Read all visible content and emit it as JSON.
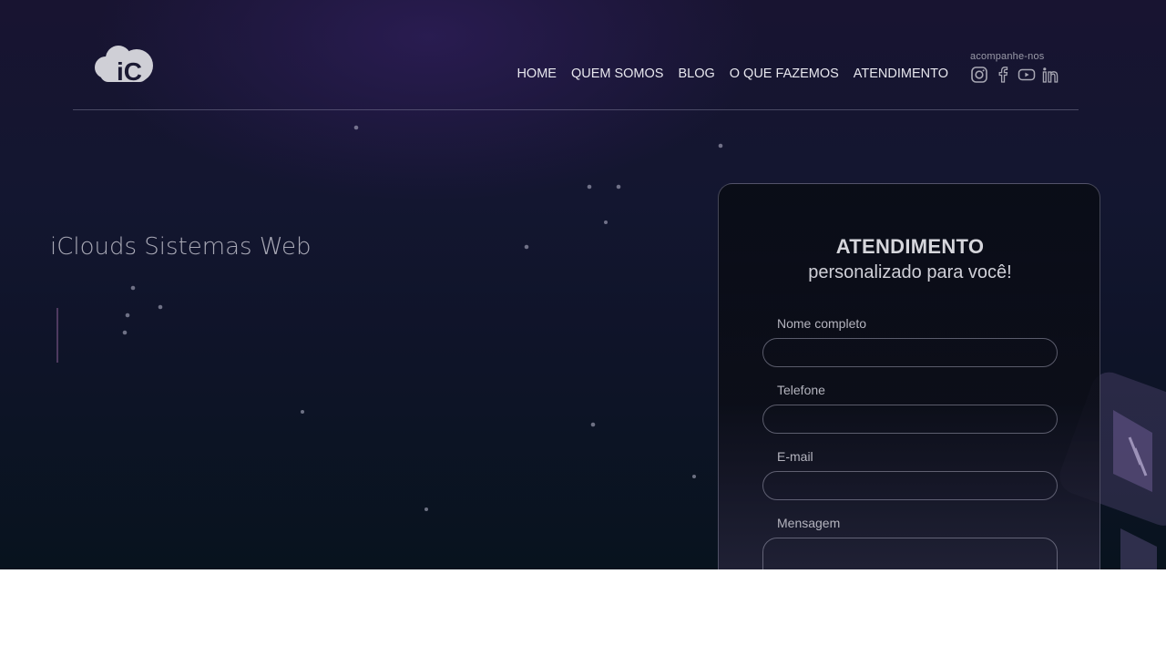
{
  "logo": {
    "text": "iC"
  },
  "nav": {
    "items": [
      "HOME",
      "QUEM SOMOS",
      "BLOG",
      "O QUE FAZEMOS",
      "ATENDIMENTO"
    ]
  },
  "social": {
    "label": "acompanhe-nos",
    "icons": [
      "instagram-icon",
      "facebook-icon",
      "youtube-icon",
      "linkedin-icon"
    ]
  },
  "hero": {
    "tagline": "iClouds Sistemas Web"
  },
  "form": {
    "title": "ATENDIMENTO",
    "subtitle": "personalizado para você!",
    "fields": [
      {
        "label": "Nome completo",
        "value": ""
      },
      {
        "label": "Telefone",
        "value": ""
      },
      {
        "label": "E-mail",
        "value": ""
      },
      {
        "label": "Mensagem",
        "value": ""
      }
    ]
  },
  "colors": {
    "background_top": "#181431",
    "background_bottom": "#08131e",
    "text": "#e7e7ee",
    "footer": "#ffffff"
  }
}
